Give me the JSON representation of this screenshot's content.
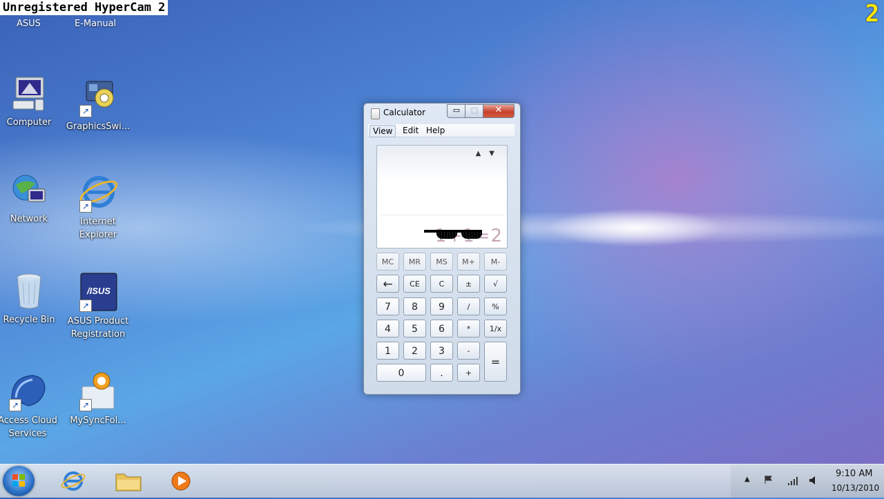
{
  "watermark": {
    "text": "Unregistered HyperCam 2",
    "badge": "2"
  },
  "top_labels": [
    "ASUS",
    "E-Manual"
  ],
  "desktop_icons": [
    {
      "label": "Computer",
      "icon": "computer-icon",
      "shortcut": false
    },
    {
      "label": "GraphicsSwi...",
      "icon": "graphics-switch-icon",
      "shortcut": true
    },
    {
      "label": "Network",
      "icon": "network-icon",
      "shortcut": false
    },
    {
      "label": "Internet Explorer",
      "icon": "internet-explorer-icon",
      "shortcut": true
    },
    {
      "label": "Recycle Bin",
      "icon": "recycle-bin-icon",
      "shortcut": false
    },
    {
      "label": "ASUS Product Registration",
      "icon": "asus-registration-icon",
      "shortcut": true
    },
    {
      "label": "Access Cloud Services",
      "icon": "cloud-services-icon",
      "shortcut": true
    },
    {
      "label": "MySyncFol...",
      "icon": "sync-folder-icon",
      "shortcut": true
    }
  ],
  "calculator": {
    "title": "Calculator",
    "window_buttons": {
      "minimize": "▭",
      "maximize": "□",
      "close": "✕"
    },
    "menu": [
      "View",
      "Edit",
      "Help"
    ],
    "history_arrows": "▲▼",
    "expression": "1+1=2",
    "memory_keys": [
      "MC",
      "MR",
      "MS",
      "M+",
      "M-"
    ],
    "row2": [
      "←",
      "CE",
      "C",
      "±",
      "√"
    ],
    "row3": [
      "7",
      "8",
      "9",
      "/",
      "%"
    ],
    "row4": [
      "4",
      "5",
      "6",
      "*",
      "1/x"
    ],
    "row5": [
      "1",
      "2",
      "3",
      "-"
    ],
    "row6": [
      "0",
      ".",
      "+"
    ],
    "equals": "="
  },
  "taskbar": {
    "time": "9:10 AM",
    "date": "10/13/2010",
    "tray_up_arrow": "▲",
    "pinned": [
      "internet-explorer-icon",
      "explorer-folder-icon",
      "media-player-icon"
    ]
  },
  "colors": {
    "close_red": "#c7432e",
    "taskbar": "#c9d3dd",
    "badge_yellow": "#ffe600"
  }
}
